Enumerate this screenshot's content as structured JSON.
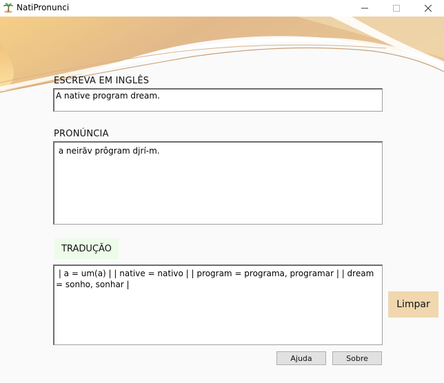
{
  "window": {
    "title": "NatiPronunci",
    "app_icon": "palm-tree-icon",
    "controls": {
      "minimize": "minimize-icon",
      "maximize": "maximize-icon",
      "close": "close-icon"
    }
  },
  "english": {
    "label": "ESCREVA EM INGLÊS",
    "value": "A native program dream."
  },
  "pronunciation": {
    "label": "PRONÚNCIA",
    "value": " a neirăv prôgram djrí-m."
  },
  "translation": {
    "label": "TRADUÇÃO",
    "value": " | a = um(a) | | native = nativo | | program = programa, programar | | dream = sonho, sonhar |"
  },
  "buttons": {
    "clear": "Limpar",
    "help": "Ajuda",
    "about": "Sobre"
  },
  "colors": {
    "banner_gold": "#e8c48e",
    "clear_button": "#f1d7ad",
    "translation_label_bg": "#edfbe9"
  }
}
